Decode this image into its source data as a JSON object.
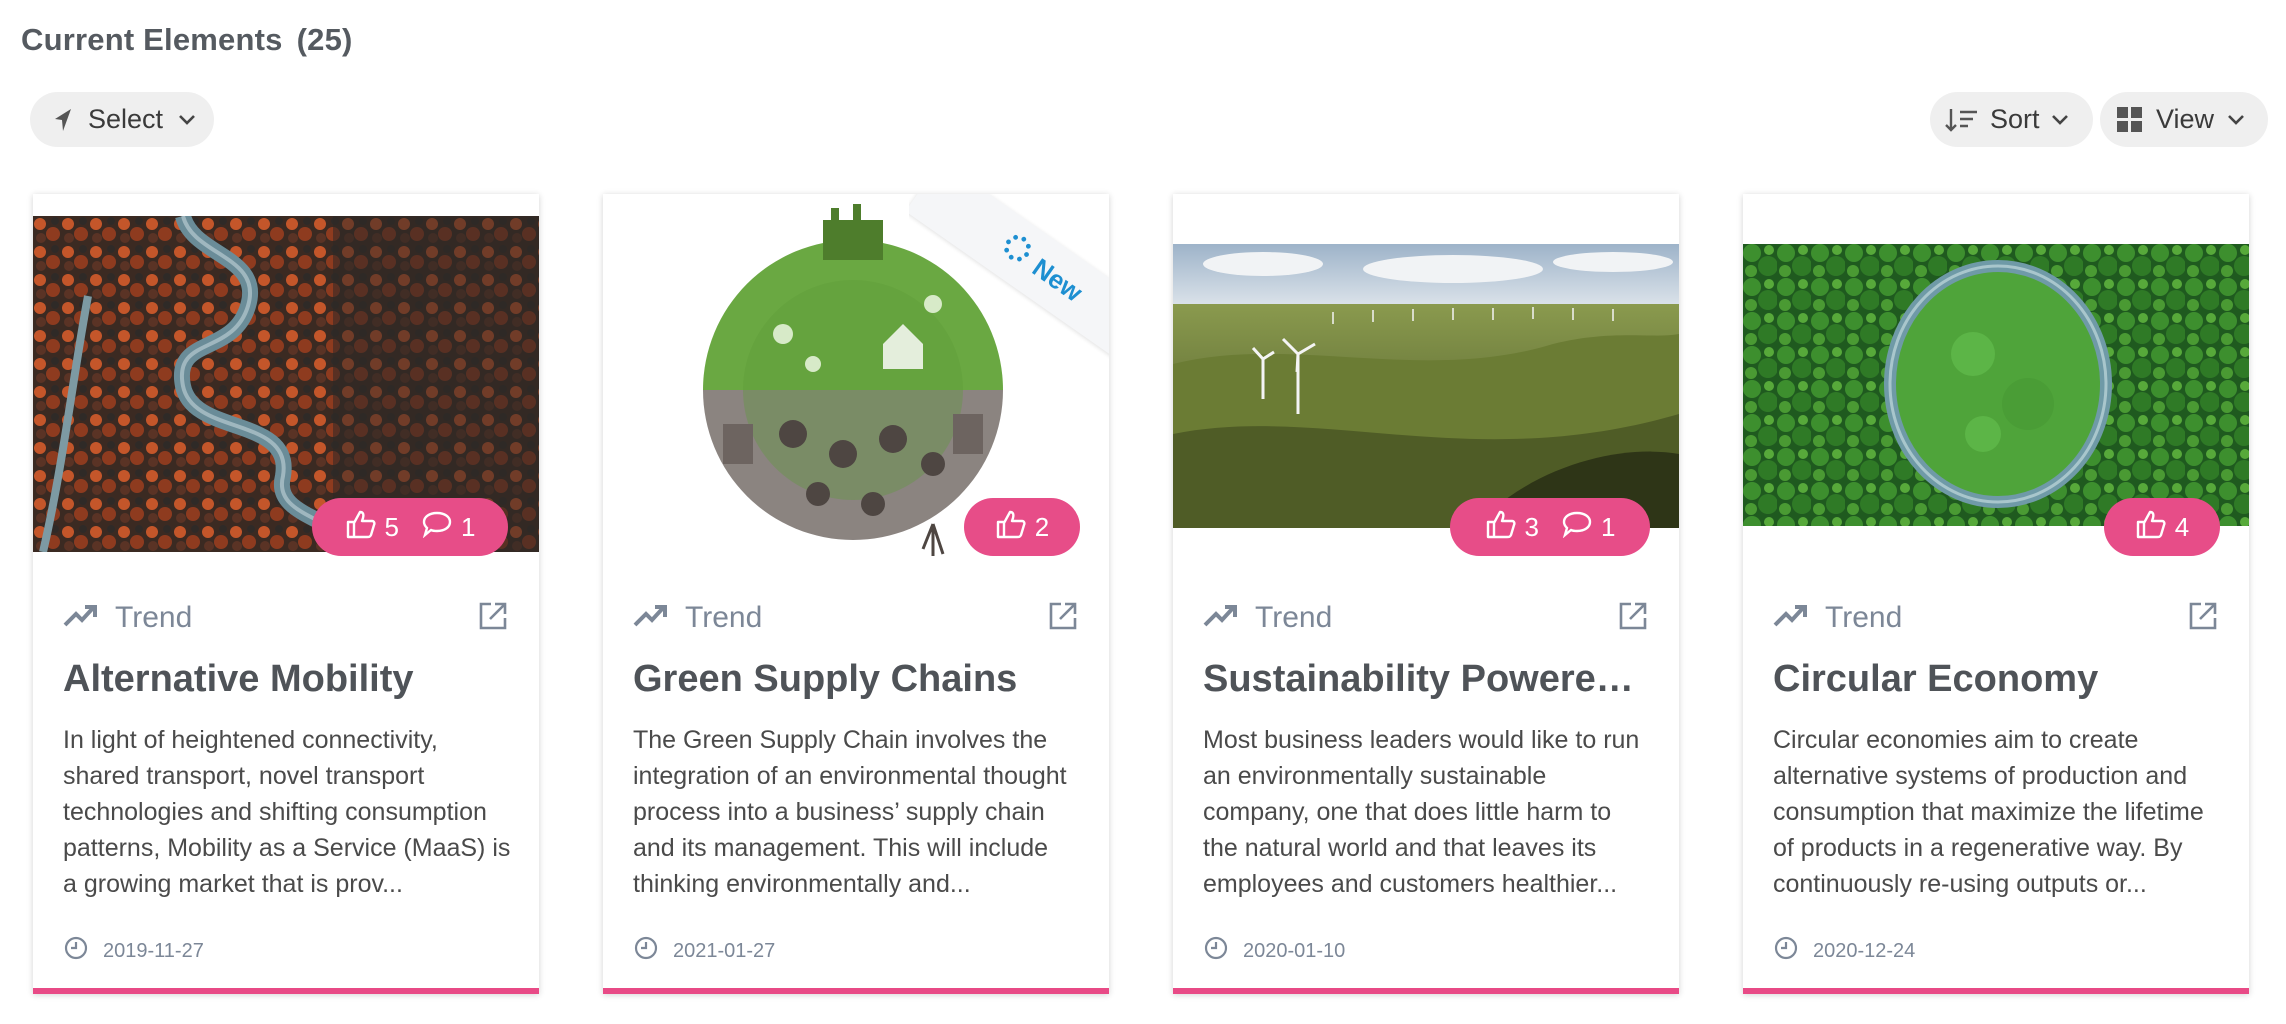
{
  "header": {
    "title": "Current Elements",
    "count": "(25)"
  },
  "toolbar": {
    "select_label": "Select",
    "sort_label": "Sort",
    "view_label": "View"
  },
  "colors": {
    "accent": "#e74d88",
    "muted": "#7c8797",
    "new_ribbon": "#1d8fd1"
  },
  "cards": [
    {
      "category": "Trend",
      "title": "Alternative Mobility",
      "description": "In light of heightened connectivity, shared transport, novel transport technologies and shifting consumption patterns, Mobility as a Service (MaaS) is a growing market that is prov...",
      "date": "2019-11-27",
      "likes": "5",
      "comments": "1",
      "image": "aerial-winding-road-forest"
    },
    {
      "category": "Trend",
      "title": "Green Supply Chains",
      "description": "The Green Supply Chain involves the integration of an environmental thought process into a business’ supply chain and its management. This will include thinking environmentally and...",
      "date": "2021-01-27",
      "likes": "2",
      "ribbon": "New",
      "image": "green-globe-illustration"
    },
    {
      "category": "Trend",
      "title": "Sustainability Powered ...",
      "description": "Most business leaders would like to run an environmentally sustainable company, one that does little harm to the natural world and that leaves its employees and customers healthier...",
      "date": "2020-01-10",
      "likes": "3",
      "comments": "1",
      "image": "wind-turbines-hills"
    },
    {
      "category": "Trend",
      "title": "Circular Economy",
      "description": "Circular economies aim to create alternative systems of production and consumption that maximize the lifetime of products in a regenerative way. By continuously re-using outputs or...",
      "date": "2020-12-24",
      "likes": "4",
      "image": "aerial-circular-forest"
    }
  ]
}
